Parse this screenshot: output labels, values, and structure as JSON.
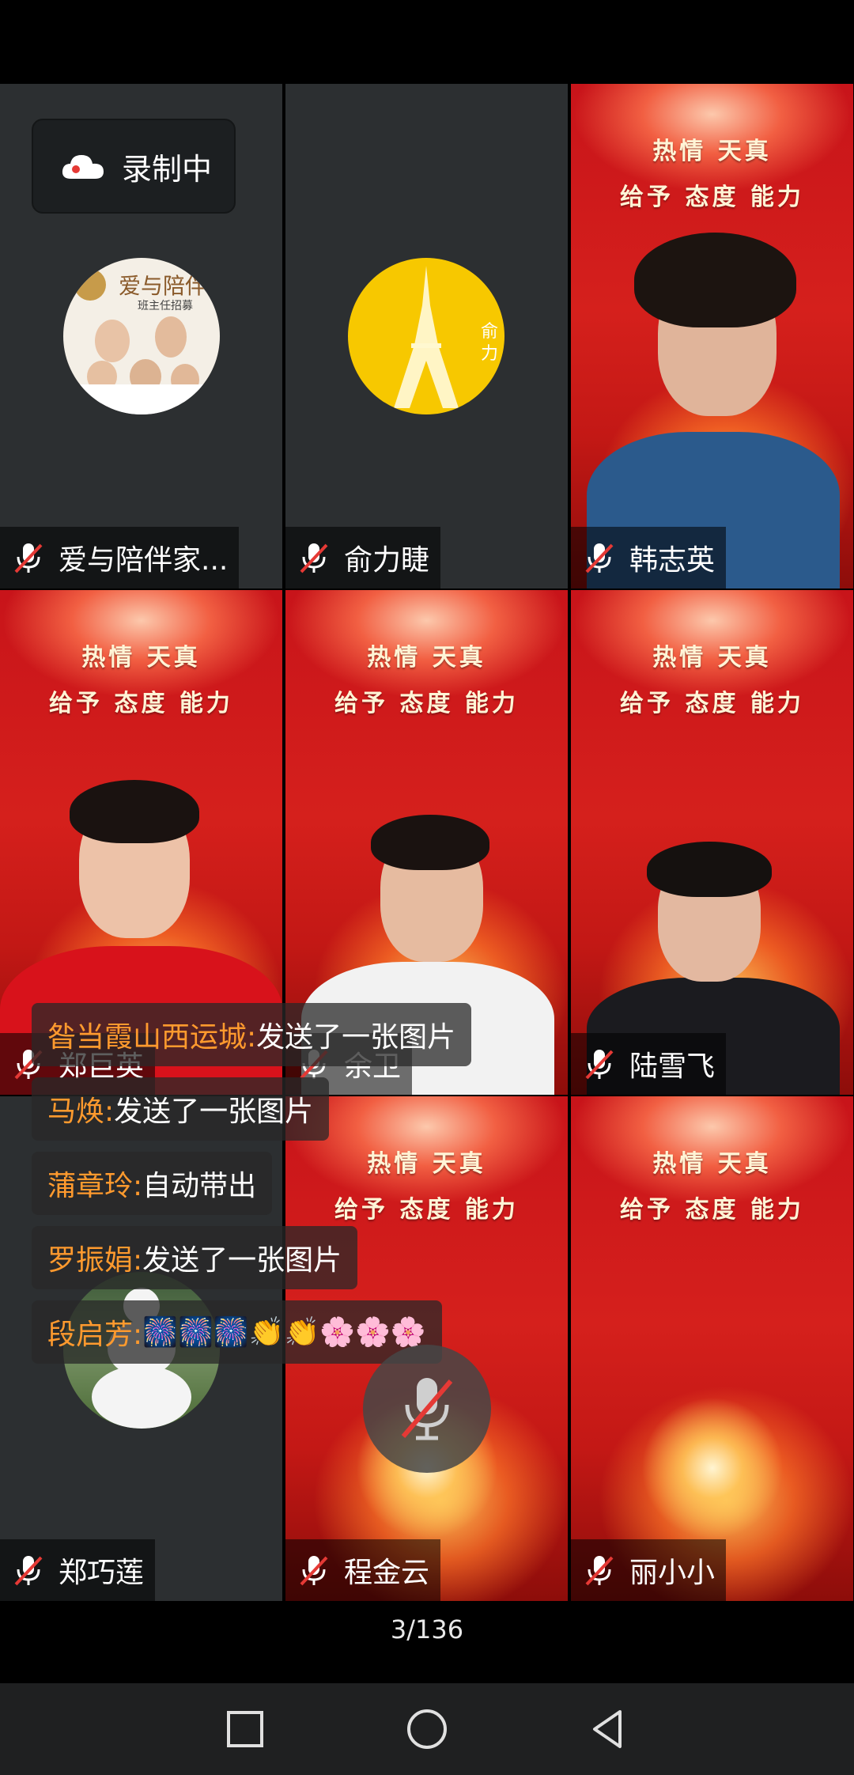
{
  "recording": {
    "label": "录制中",
    "icon": "cloud-icon"
  },
  "poster_slogan": {
    "line1": "热情 天真",
    "line2": "给予 态度 能力"
  },
  "participants": [
    {
      "name": "爱与陪伴家...",
      "mic": "muted",
      "view": "avatar-poster",
      "avatar_text": "爱与陪伴",
      "avatar_subtext": "班主任招募"
    },
    {
      "name": "俞力睫",
      "mic": "muted",
      "view": "avatar-tower",
      "avatar_text": "俞力"
    },
    {
      "name": "韩志英",
      "mic": "muted",
      "view": "video"
    },
    {
      "name": "郑巨英",
      "mic": "muted",
      "view": "video"
    },
    {
      "name": "余卫",
      "mic": "muted",
      "view": "video"
    },
    {
      "name": "陆雪飞",
      "mic": "muted",
      "view": "video"
    },
    {
      "name": "郑巧莲",
      "mic": "muted",
      "view": "avatar-statue"
    },
    {
      "name": "程金云",
      "mic": "muted",
      "view": "video-background"
    },
    {
      "name": "丽小小",
      "mic": "muted",
      "view": "video-background"
    }
  ],
  "chat": [
    {
      "sender": "昝当霞山西运城:",
      "message": "发送了一张图片"
    },
    {
      "sender": "马焕:",
      "message": "发送了一张图片"
    },
    {
      "sender": "蒲章玲:",
      "message": "自动带出"
    },
    {
      "sender": "罗振娟:",
      "message": "发送了一张图片"
    },
    {
      "sender": "段启芳:",
      "message": "🎆🎆🎆👏👏🌸🌸🌸"
    }
  ],
  "page_counter": "3/136",
  "nav": {
    "recent": "square-icon",
    "home": "circle-icon",
    "back": "triangle-back-icon"
  },
  "colors": {
    "tile_dark": "#2c2f31",
    "poster_red": "#d5201c",
    "chat_sender": "#ff9a2e",
    "nav_bg": "#1f2021"
  }
}
